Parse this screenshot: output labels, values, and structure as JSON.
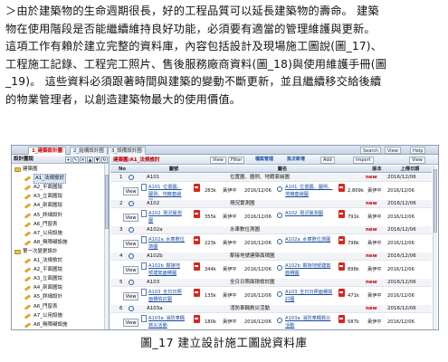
{
  "paragraph": {
    "lines": [
      "＞由於建築物的生命週期很長，好的工程品質可以延長建築物的壽命。 建築",
      "物在使用階段是否能繼續維持良好功能，必須要有適當的管理維護與更新。",
      "這項工作有賴於建立完整的資料庫，內容包括設計及現場施工圖說(圖_17)、",
      "工程施工記錄、工程完工照片、售後服務廠商資料(圖_18)與使用維護手冊(圖",
      "_19)。 這些資料必須跟著時間與建築的變動不斷更新，並且繼續移交給後續",
      "的物業管理者，以創造建築物最大的使用價值。"
    ]
  },
  "app": {
    "tabs": [
      "1_建築設計圖",
      "2_結構設計圖",
      "3_設備設計圖"
    ],
    "right_controls": [
      "Search",
      "View",
      "Help"
    ],
    "tree_title": "設計圖說",
    "tree": [
      {
        "label": "建築圖",
        "type": "folder",
        "indent": 0
      },
      {
        "label": "A1_法規檢討",
        "type": "file",
        "indent": 1,
        "selected": true
      },
      {
        "label": "A2_平面圖說",
        "type": "file",
        "indent": 1
      },
      {
        "label": "A3_立面圖說",
        "type": "file",
        "indent": 1
      },
      {
        "label": "A4_剖面圖說",
        "type": "file",
        "indent": 1
      },
      {
        "label": "A5_詳細設計",
        "type": "file",
        "indent": 1
      },
      {
        "label": "A6_門窗表",
        "type": "file",
        "indent": 1
      },
      {
        "label": "A7_公用設施",
        "type": "file",
        "indent": 1
      },
      {
        "label": "A8_無障礙設施",
        "type": "file",
        "indent": 1
      },
      {
        "label": "第一次變更設計",
        "type": "folder",
        "indent": 0
      },
      {
        "label": "A1_法規檢討",
        "type": "file",
        "indent": 1
      },
      {
        "label": "A2_平面圖說",
        "type": "file",
        "indent": 1
      },
      {
        "label": "A3_立面圖說",
        "type": "file",
        "indent": 1
      },
      {
        "label": "A4_剖面圖說",
        "type": "file",
        "indent": 1
      },
      {
        "label": "A5_詳細設計",
        "type": "file",
        "indent": 1
      },
      {
        "label": "A6_門窗表",
        "type": "file",
        "indent": 1
      },
      {
        "label": "A7_公用設施",
        "type": "file",
        "indent": 1
      },
      {
        "label": "A8_無障礙設施",
        "type": "file",
        "indent": 1
      }
    ],
    "breadcrumb": "建築圖/A1_法規檢討",
    "toolbar": {
      "view": "View",
      "filter": "Filter",
      "search_files": "檔案管理",
      "batch_add": "批次新增",
      "add": "Add",
      "import": "Import",
      "view2": "View"
    },
    "columns": {
      "no": "No",
      "code": "圖號",
      "name": "圖名",
      "version": "版本",
      "date": "上傳日期"
    },
    "rows": [
      {
        "no": "1",
        "code": "A101",
        "name": "位置圖、圖例、地籍套繪圖",
        "version": "new",
        "date": "2016/12/06",
        "file1": "A101_位置圖、圖例、地籍套繪圖",
        "size1": "283k",
        "user1": "黃伊平",
        "date1": "2016/12/06",
        "file2": "A101_位置圖、圖例、地籍套繪圖",
        "size2": "2,809k",
        "user2": "黃伊平",
        "date2": "2016/12/06"
      },
      {
        "no": "2",
        "code": "A102",
        "name": "現況實測圖",
        "version": "new",
        "date": "2016/12/06",
        "file1": "A102_現況實測圖",
        "size1": "355k",
        "user1": "黃伊平",
        "date1": "2016/12/06",
        "file2": "A102_現況實測圖",
        "size2": "791k",
        "user2": "黃伊平",
        "date2": "2016/12/06"
      },
      {
        "no": "3",
        "code": "A102a",
        "name": "水車數位測圖",
        "version": "new",
        "date": "2016/12/06",
        "file1": "A102a_水車數位測圖",
        "size1": "223k",
        "user1": "黃伊平",
        "date1": "2016/12/06",
        "file2": "A102a_水車數位測圖",
        "size2": "798k",
        "user2": "黃伊平",
        "date2": "2016/12/06"
      },
      {
        "no": "4",
        "code": "A102b",
        "name": "鄰接地號建築面積圖",
        "version": "new",
        "date": "2016/12/06",
        "file1": "A102b_鄰接地號建築面積圖",
        "size1": "344k",
        "user1": "黃伊平",
        "date1": "2016/12/06",
        "file2": "A102b_鄰接地號建築面積圖",
        "size2": "898k",
        "user2": "黃伊平",
        "date2": "2016/12/06"
      },
      {
        "no": "5",
        "code": "A103",
        "name": "全日日照面積檢討圖",
        "version": "new",
        "date": "2016/12/06",
        "file1": "A103_全日日照面積檢討圖",
        "size1": "135k",
        "user1": "黃伊平",
        "date1": "2016/12/06",
        "file2": "A103_全日日照面積檢討圖",
        "size2": "471k",
        "user2": "黃伊平",
        "date2": "2016/12/06"
      },
      {
        "no": "6",
        "code": "A103a",
        "name": "消防車輛救災活動",
        "version": "new",
        "date": "2016/12/06",
        "file1": "A103a_消防車輛救災活動",
        "size1": "180k",
        "user1": "黃伊平",
        "date1": "2016/12/06",
        "file2": "A103a_消防車輛救災活動",
        "size2": "587k",
        "user2": "黃伊平",
        "date2": "2016/12/06"
      }
    ]
  },
  "caption": "圖_17  建立設計施工圖說資料庫"
}
